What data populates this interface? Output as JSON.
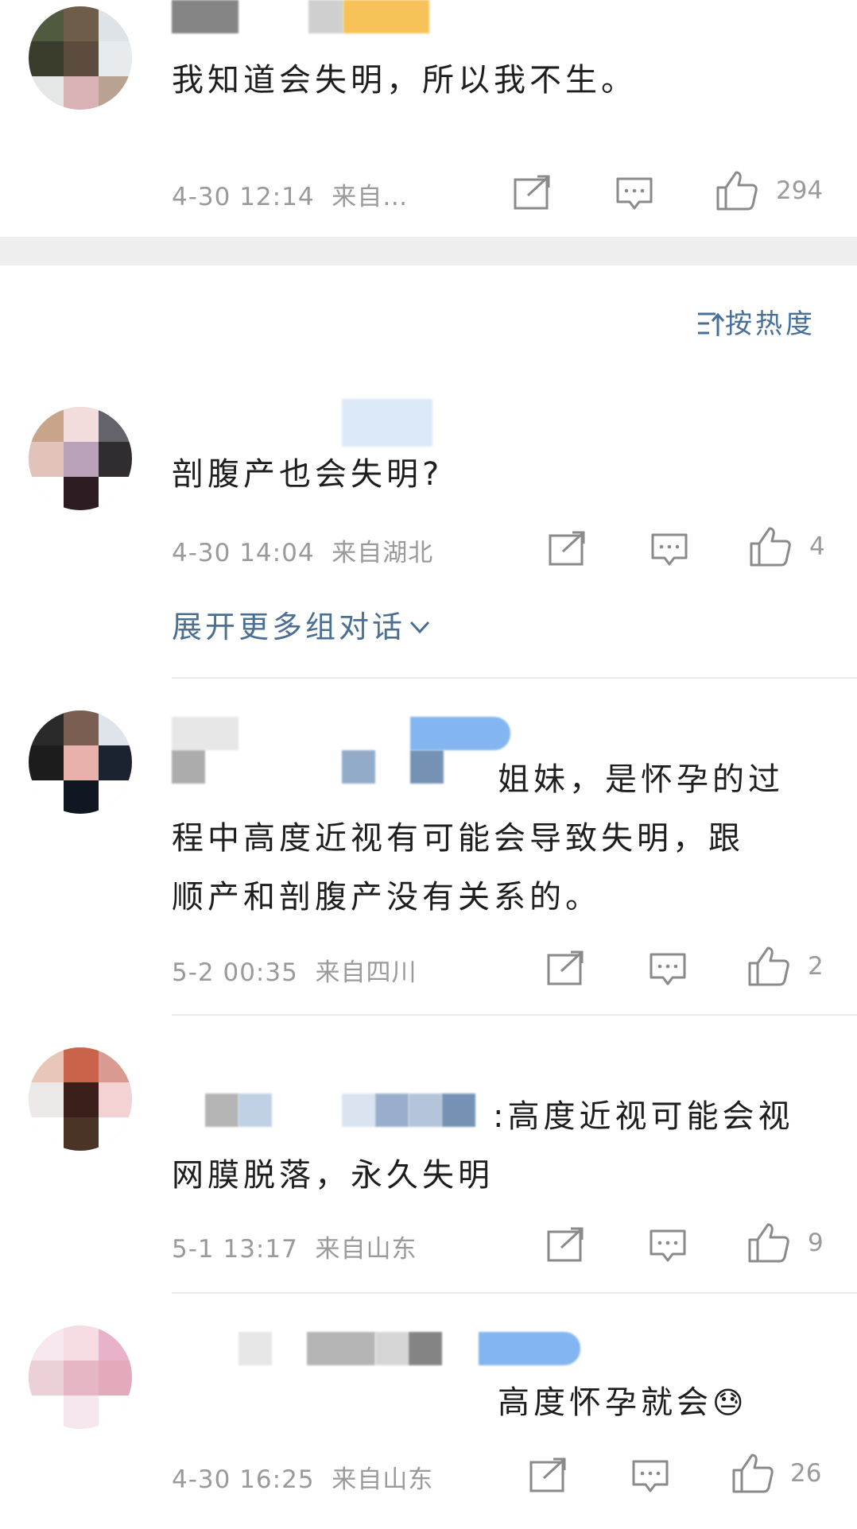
{
  "comments": [
    {
      "text": "我知道会失明，所以我不生。",
      "time": "4-30 12:14",
      "source": "来自…",
      "likes": "294"
    },
    {
      "text": "剖腹产也会失明?",
      "time": "4-30 14:04",
      "source": "来自湖北",
      "likes": "4"
    },
    {
      "text": "姐妹，是怀孕的过程中高度近视有可能会导致失明，跟顺产和剖腹产没有关系的。",
      "line1": "姐妹，是怀孕的过",
      "line2": "程中高度近视有可能会导致失明，跟",
      "line3": "顺产和剖腹产没有关系的。",
      "time": "5-2 00:35",
      "source": "来自四川",
      "likes": "2"
    },
    {
      "line1": ":高度近视可能会视",
      "line2": "网膜脱落，永久失明",
      "time": "5-1 13:17",
      "source": "来自山东",
      "likes": "9"
    },
    {
      "line1": "高度怀孕就会",
      "emoji": "😓",
      "time": "4-30 16:25",
      "source": "来自山东",
      "likes": "26"
    }
  ],
  "sort_label": "按热度",
  "expand_label": "展开更多组对话",
  "icons": [
    "share-icon",
    "comment-icon",
    "like-icon",
    "sort-icon",
    "chevron-down-icon"
  ],
  "colors": {
    "link": "#4a6f93",
    "meta": "#9a9a9a",
    "separator": "#eeeeee"
  }
}
